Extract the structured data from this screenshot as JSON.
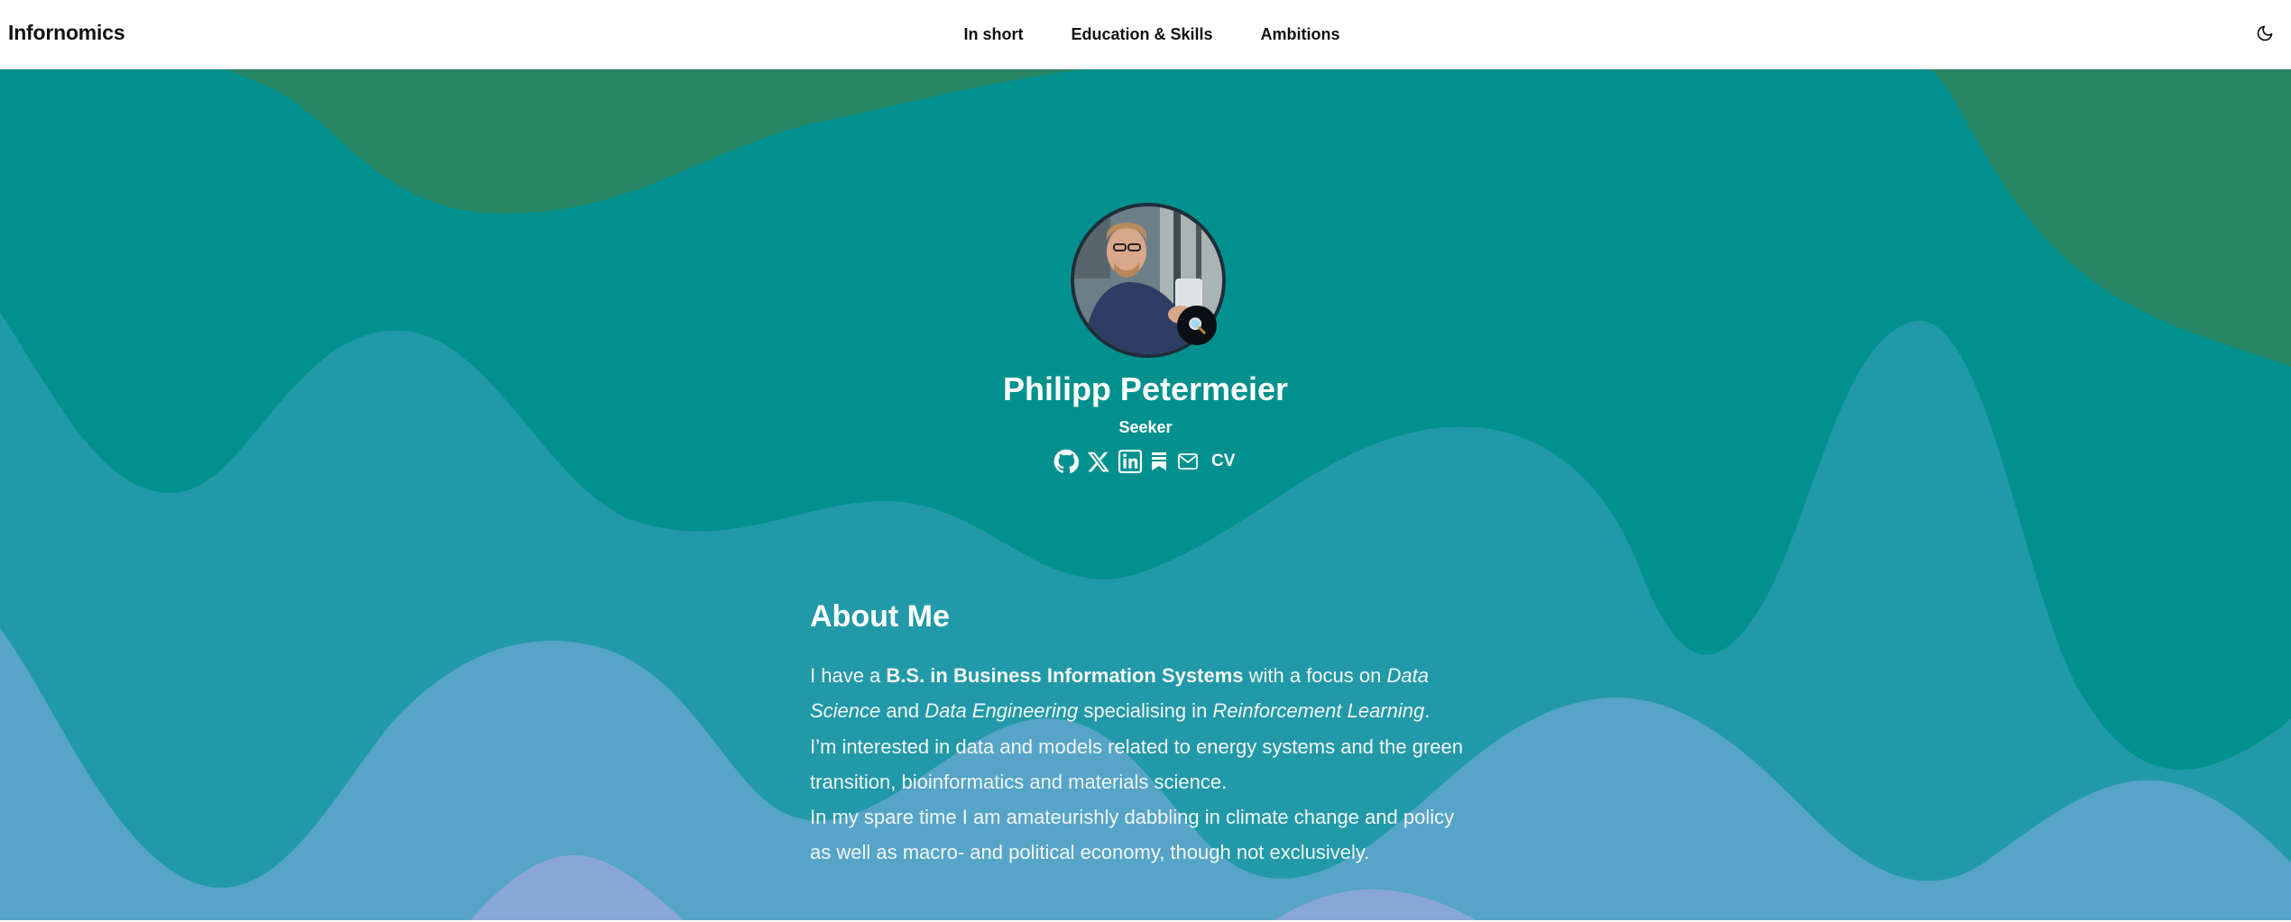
{
  "header": {
    "brand": "Infornomics",
    "nav": [
      {
        "label": "In short"
      },
      {
        "label": "Education & Skills"
      },
      {
        "label": "Ambitions"
      }
    ],
    "theme_toggle_icon": "moon-icon"
  },
  "profile": {
    "name": "Philipp Petermeier",
    "subtitle": "Seeker",
    "avatar_badge_icon": "magnifier-icon",
    "socials": [
      {
        "icon": "github-icon"
      },
      {
        "icon": "x-twitter-icon"
      },
      {
        "icon": "linkedin-icon"
      },
      {
        "icon": "bookmark-icon"
      },
      {
        "icon": "mail-icon"
      }
    ],
    "cv_label": "CV"
  },
  "about": {
    "heading": "About Me",
    "p1_a": "I have a ",
    "p1_b": "B.S. in Business Information Systems",
    "p1_c": " with a focus on ",
    "p1_d": "Data Science",
    "p1_e": " and ",
    "p1_f": "Data Engineering",
    "p1_g": " specialising in ",
    "p1_h": "Reinforcement Learning",
    "p1_i": ".",
    "p2": "I’m interested in data and models related to energy systems and the green transition, bioinformatics and materials science.",
    "p3": "In my spare time I am amateurishly dabbling in climate change and policy as well as macro- and political economy, though not exclusively."
  },
  "colors": {
    "hero_base": "#00918e",
    "wave_green": "#268563",
    "wave_teal": "#2299a8",
    "wave_light": "#56a4c8",
    "wave_lilac": "#8aa6d6"
  }
}
